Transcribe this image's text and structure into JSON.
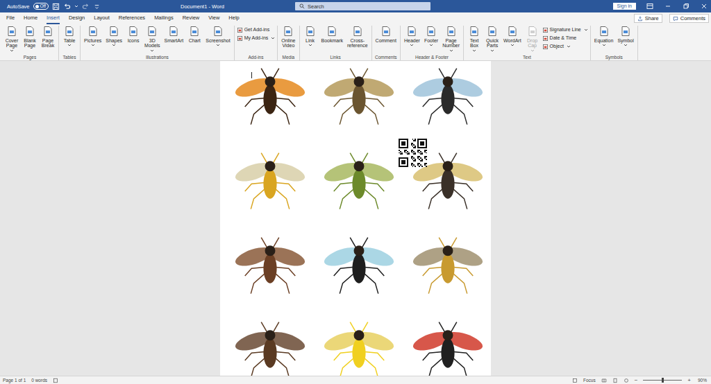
{
  "window": {
    "title": "Document1 - Word"
  },
  "title_bar": {
    "autosave": {
      "label": "AutoSave",
      "toggle": "Off",
      "on": false
    },
    "search": {
      "placeholder": "Search"
    },
    "sign_in": "Sign in"
  },
  "tabs": [
    {
      "label": "File",
      "selected": false
    },
    {
      "label": "Home",
      "selected": false
    },
    {
      "label": "Insert",
      "selected": true
    },
    {
      "label": "Design",
      "selected": false
    },
    {
      "label": "Layout",
      "selected": false
    },
    {
      "label": "References",
      "selected": false
    },
    {
      "label": "Mailings",
      "selected": false
    },
    {
      "label": "Review",
      "selected": false
    },
    {
      "label": "View",
      "selected": false
    },
    {
      "label": "Help",
      "selected": false
    }
  ],
  "tab_actions": [
    "Share",
    "Comments"
  ],
  "ribbon": {
    "groups": [
      {
        "name": "Pages",
        "items": [
          {
            "label": "Cover Page",
            "kind": "large",
            "menu": true,
            "disabled": false
          },
          {
            "label": "Blank Page",
            "kind": "large",
            "menu": false,
            "disabled": false
          },
          {
            "label": "Page Break",
            "kind": "large",
            "menu": false,
            "disabled": false
          }
        ]
      },
      {
        "name": "Tables",
        "items": [
          {
            "label": "Table",
            "kind": "large",
            "menu": true,
            "disabled": false
          }
        ]
      },
      {
        "name": "Illustrations",
        "items": [
          {
            "label": "Pictures",
            "kind": "large",
            "menu": true,
            "disabled": false
          },
          {
            "label": "Shapes",
            "kind": "large",
            "menu": true,
            "disabled": false
          },
          {
            "label": "Icons",
            "kind": "large",
            "menu": false,
            "disabled": false
          },
          {
            "label": "3D Models",
            "kind": "large",
            "menu": true,
            "disabled": false
          },
          {
            "label": "SmartArt",
            "kind": "large",
            "menu": false,
            "disabled": false
          },
          {
            "label": "Chart",
            "kind": "large",
            "menu": false,
            "disabled": false
          },
          {
            "label": "Screenshot",
            "kind": "large",
            "menu": true,
            "disabled": false
          }
        ]
      },
      {
        "name": "Add-ins",
        "items": [
          {
            "label": "Get Add-ins",
            "kind": "small",
            "menu": false,
            "disabled": false
          },
          {
            "label": "My Add-ins",
            "kind": "small",
            "menu": true,
            "disabled": false
          }
        ]
      },
      {
        "name": "Media",
        "items": [
          {
            "label": "Online Video",
            "kind": "large",
            "menu": false,
            "disabled": false
          }
        ]
      },
      {
        "name": "Links",
        "items": [
          {
            "label": "Link",
            "kind": "large",
            "menu": true,
            "disabled": false
          },
          {
            "label": "Bookmark",
            "kind": "large",
            "menu": false,
            "disabled": false
          },
          {
            "label": "Cross-reference",
            "kind": "large",
            "menu": false,
            "disabled": false
          }
        ]
      },
      {
        "name": "Comments",
        "items": [
          {
            "label": "Comment",
            "kind": "large",
            "menu": false,
            "disabled": false
          }
        ]
      },
      {
        "name": "Header & Footer",
        "items": [
          {
            "label": "Header",
            "kind": "large",
            "menu": true,
            "disabled": false
          },
          {
            "label": "Footer",
            "kind": "large",
            "menu": true,
            "disabled": false
          },
          {
            "label": "Page Number",
            "kind": "large",
            "menu": true,
            "disabled": false
          }
        ]
      },
      {
        "name": "Text",
        "items": [
          {
            "label": "Text Box",
            "kind": "large",
            "menu": true,
            "disabled": false
          },
          {
            "label": "Quick Parts",
            "kind": "large",
            "menu": true,
            "disabled": false
          },
          {
            "label": "WordArt",
            "kind": "large",
            "menu": true,
            "disabled": false
          },
          {
            "label": "Drop Cap",
            "kind": "large",
            "menu": true,
            "disabled": true
          },
          {
            "label": "Signature Line",
            "kind": "small",
            "menu": true,
            "disabled": false
          },
          {
            "label": "Date & Time",
            "kind": "small",
            "menu": false,
            "disabled": false
          },
          {
            "label": "Object",
            "kind": "small",
            "menu": true,
            "disabled": false
          }
        ]
      },
      {
        "name": "Symbols",
        "items": [
          {
            "label": "Equation",
            "kind": "large",
            "menu": true,
            "disabled": false
          },
          {
            "label": "Symbol",
            "kind": "large",
            "menu": true,
            "disabled": false
          }
        ]
      }
    ]
  },
  "document": {
    "pictures": [
      {
        "kind": "photo"
      },
      {
        "kind": "photo"
      },
      {
        "kind": "photo"
      },
      {
        "kind": "photo"
      },
      {
        "kind": "photo"
      },
      {
        "kind": "qr"
      },
      {
        "kind": "photo"
      },
      {
        "kind": "photo"
      },
      {
        "kind": "photo"
      },
      {
        "kind": "photo"
      },
      {
        "kind": "photo"
      },
      {
        "kind": "photo"
      },
      {
        "kind": "photo"
      }
    ]
  },
  "status_bar": {
    "page": "Page 1 of 1",
    "words": "0 words",
    "focus": "Focus",
    "zoom_out": "−",
    "zoom_in": "+",
    "zoom_level": 0.5,
    "zoom": "90%"
  }
}
